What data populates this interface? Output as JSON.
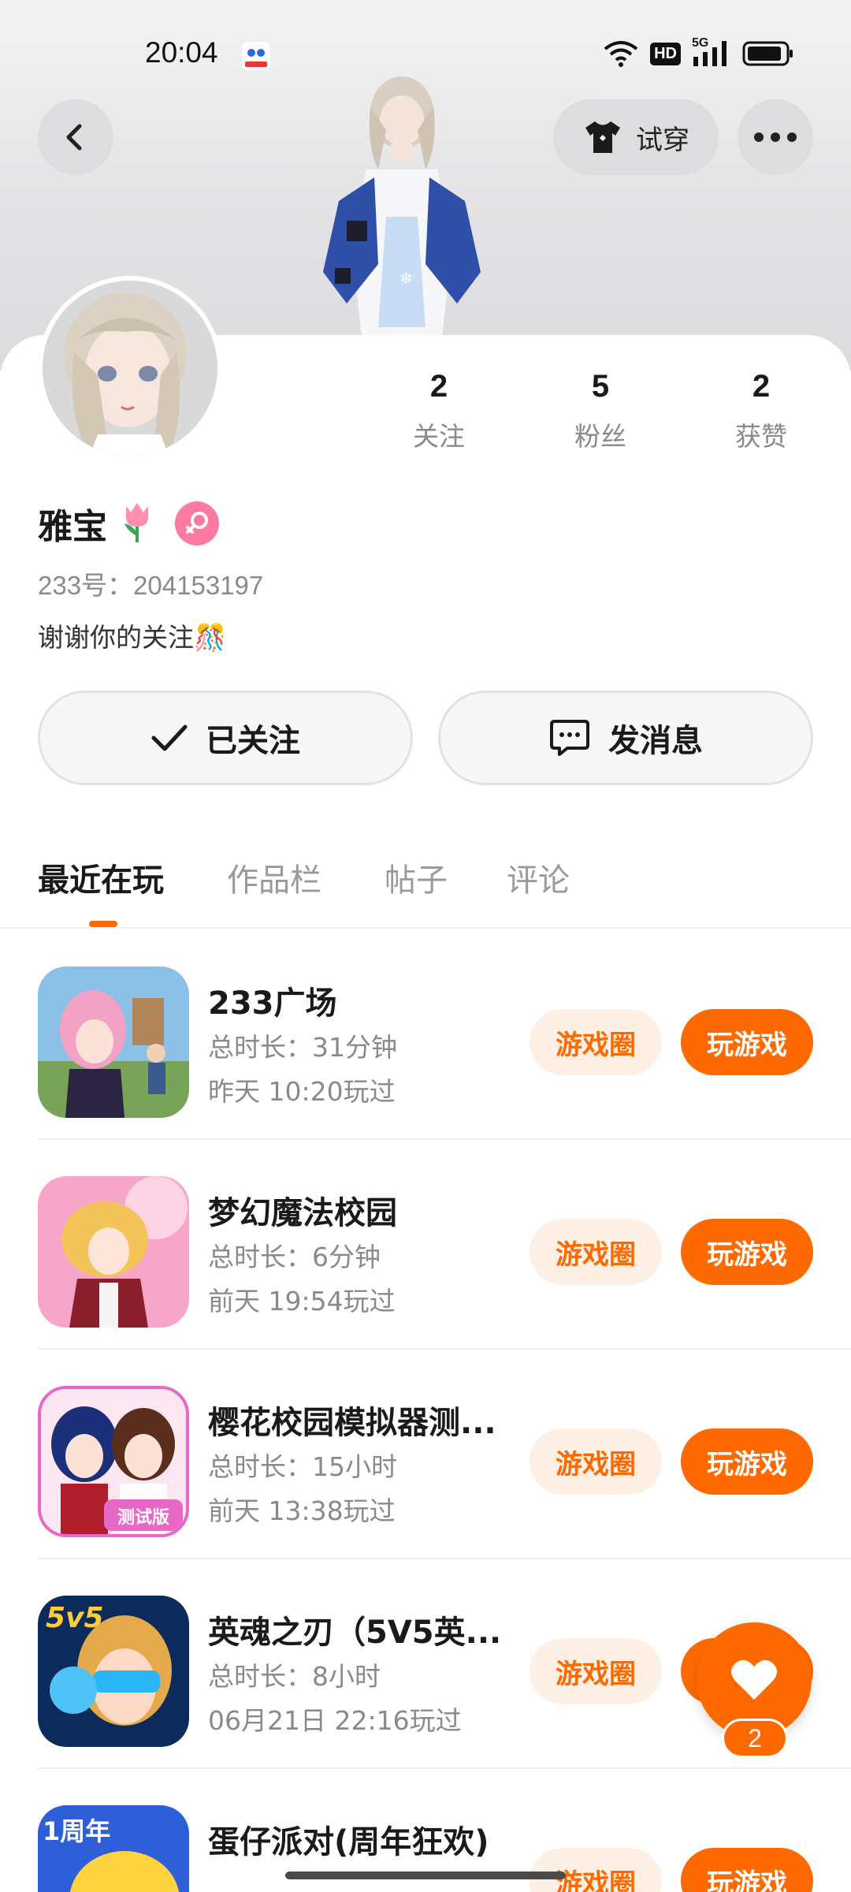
{
  "status_bar": {
    "time": "20:04",
    "network_label": "HD",
    "signal_label": "5G"
  },
  "header": {
    "tryon_label": "试穿"
  },
  "stats": [
    {
      "value": "2",
      "label": "关注"
    },
    {
      "value": "5",
      "label": "粉丝"
    },
    {
      "value": "2",
      "label": "获赞"
    }
  ],
  "profile": {
    "name": "雅宝",
    "id_text": "233号：204153197",
    "bio": "谢谢你的关注🎊"
  },
  "actions": {
    "follow_label": "已关注",
    "message_label": "发消息"
  },
  "tabs": [
    {
      "label": "最近在玩"
    },
    {
      "label": "作品栏"
    },
    {
      "label": "帖子"
    },
    {
      "label": "评论"
    }
  ],
  "games": [
    {
      "title": "233广场",
      "duration": "总时长：31分钟",
      "last_played": "昨天 10:20玩过",
      "circle_label": "游戏圈",
      "play_label": "玩游戏"
    },
    {
      "title": "梦幻魔法校园",
      "duration": "总时长：6分钟",
      "last_played": "前天 19:54玩过",
      "circle_label": "游戏圈",
      "play_label": "玩游戏"
    },
    {
      "title": "樱花校园模拟器测...",
      "duration": "总时长：15小时",
      "last_played": "前天 13:38玩过",
      "circle_label": "游戏圈",
      "play_label": "玩游戏"
    },
    {
      "title": "英魂之刃（5V5英...",
      "duration": "总时长：8小时",
      "last_played": "06月21日 22:16玩过",
      "circle_label": "游戏圈",
      "play_label": "玩游戏"
    },
    {
      "title": "蛋仔派对(周年狂欢)",
      "duration": "",
      "last_played": "",
      "circle_label": "游戏圈",
      "play_label": "玩游戏"
    }
  ],
  "game_icon_text": {
    "test_badge": "测试版",
    "vs_badge": "5v5",
    "anniv_badge": "1周年"
  },
  "fab": {
    "count": "2"
  },
  "colors": {
    "accent": "#ff6a00",
    "accent_soft": "#fff0e6",
    "gender": "#ff7aa2"
  },
  "icons": [
    "back-icon",
    "shirt-icon",
    "more-icon",
    "check-icon",
    "chat-bubble-icon",
    "heart-icon",
    "female-icon",
    "tulip-icon"
  ]
}
